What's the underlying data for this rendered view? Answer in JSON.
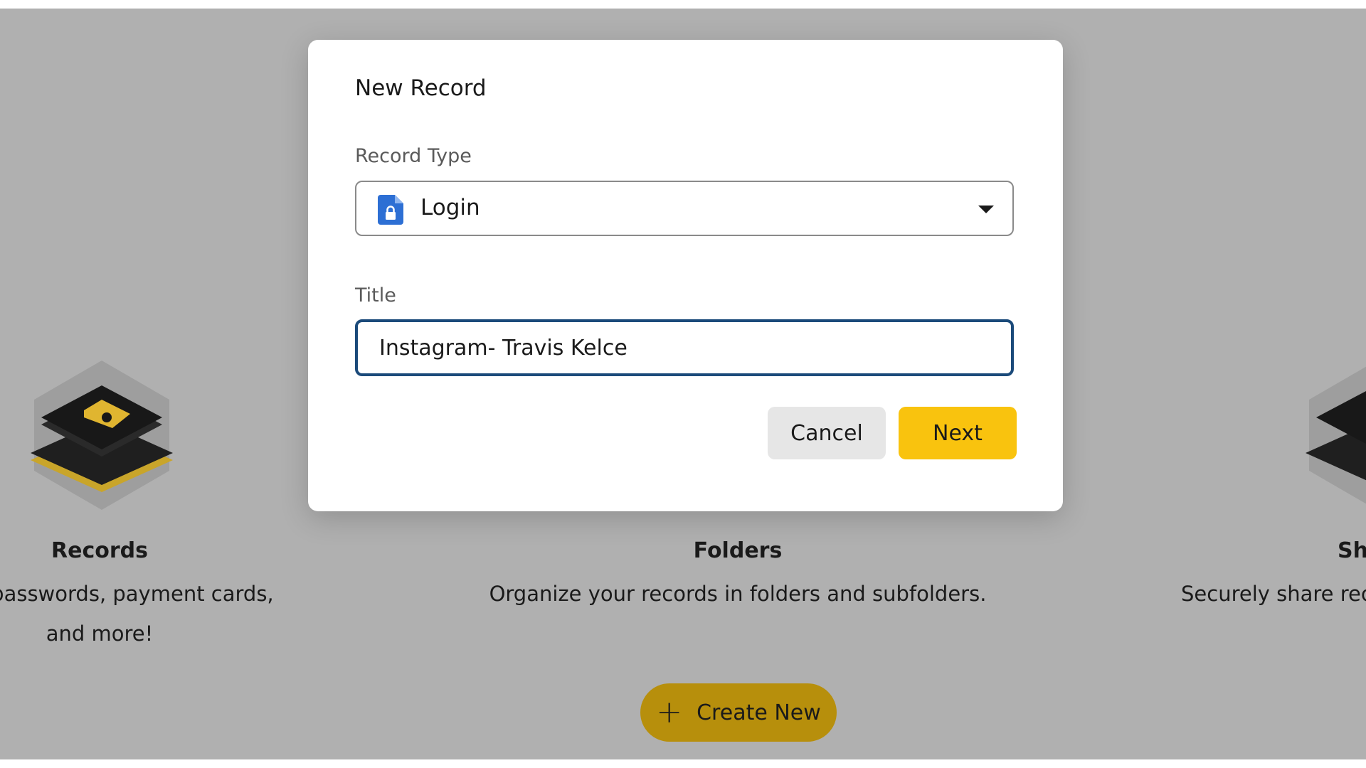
{
  "background": {
    "cards": [
      {
        "title": "Records",
        "description_line1": "ds for passwords, payment cards,",
        "description_line2": "and more!",
        "icon": "record-lock-icon"
      },
      {
        "title": "Folders",
        "description_line1": "Organize your records in folders and subfolders.",
        "icon": "folder-icon"
      },
      {
        "title": "Sha",
        "description_line1": "Securely share rec",
        "icon": "share-icon"
      }
    ],
    "create_button": {
      "label": "Create New",
      "icon": "plus-icon"
    }
  },
  "modal": {
    "title": "New Record",
    "record_type": {
      "label": "Record Type",
      "value": "Login",
      "icon": "login-file-icon"
    },
    "title_field": {
      "label": "Title",
      "value": "Instagram- Travis Kelce"
    },
    "buttons": {
      "cancel": "Cancel",
      "next": "Next"
    }
  },
  "colors": {
    "accent_yellow": "#f9c30e",
    "focus_border": "#1b4a7a",
    "overlay": "#b0b0b0",
    "icon_blue": "#2d6fd4"
  }
}
